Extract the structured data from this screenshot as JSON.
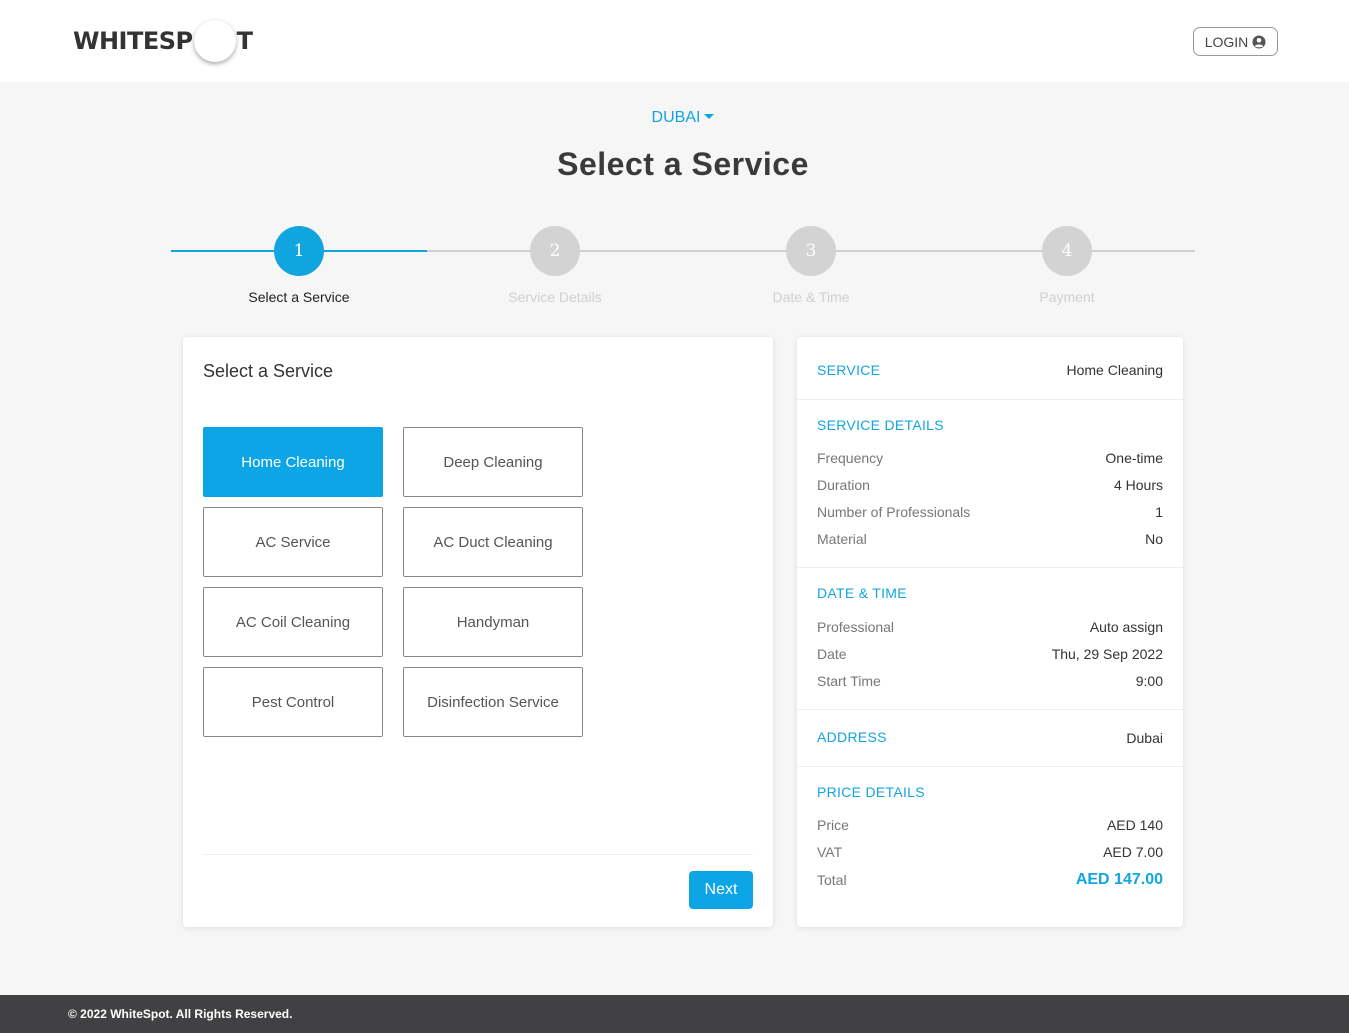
{
  "header": {
    "logo_left": "WHITESP",
    "logo_right": "T",
    "login_label": "LOGIN",
    "login_icon": "user-circle-icon"
  },
  "city": {
    "label": "DUBAI",
    "icon": "caret-down-icon"
  },
  "page_title": "Select a Service",
  "steps": [
    {
      "number": "1",
      "label": "Select a Service",
      "active": true
    },
    {
      "number": "2",
      "label": "Service Details",
      "active": false
    },
    {
      "number": "3",
      "label": "Date & Time",
      "active": false
    },
    {
      "number": "4",
      "label": "Payment",
      "active": false
    }
  ],
  "services_card": {
    "title": "Select a Service",
    "services": [
      {
        "label": "Home Cleaning",
        "selected": true
      },
      {
        "label": "Deep Cleaning",
        "selected": false
      },
      {
        "label": "AC Service",
        "selected": false
      },
      {
        "label": "AC Duct Cleaning",
        "selected": false
      },
      {
        "label": "AC Coil Cleaning",
        "selected": false
      },
      {
        "label": "Handyman",
        "selected": false
      },
      {
        "label": "Pest Control",
        "selected": false
      },
      {
        "label": "Disinfection Service",
        "selected": false
      }
    ],
    "next_label": "Next"
  },
  "summary": {
    "service": {
      "heading": "SERVICE",
      "value": "Home Cleaning"
    },
    "service_details": {
      "heading": "SERVICE DETAILS",
      "rows": [
        {
          "key": "Frequency",
          "value": "One-time"
        },
        {
          "key": "Duration",
          "value": "4 Hours"
        },
        {
          "key": "Number of Professionals",
          "value": "1"
        },
        {
          "key": "Material",
          "value": "No"
        }
      ]
    },
    "date_time": {
      "heading": "DATE & TIME",
      "rows": [
        {
          "key": "Professional",
          "value": "Auto assign"
        },
        {
          "key": "Date",
          "value": "Thu, 29 Sep 2022"
        },
        {
          "key": "Start Time",
          "value": "9:00"
        }
      ]
    },
    "address": {
      "heading": "ADDRESS",
      "value": "Dubai"
    },
    "price_details": {
      "heading": "PRICE DETAILS",
      "rows": [
        {
          "key": "Price",
          "value": "AED 140"
        },
        {
          "key": "VAT",
          "value": "AED 7.00"
        },
        {
          "key": "Total",
          "value": "AED 147.00"
        }
      ]
    }
  },
  "footer": {
    "text": "© 2022 WhiteSpot. All Rights Reserved."
  },
  "colors": {
    "accent": "#11a5e0",
    "footer_bg": "#414143",
    "step_inactive": "#d3d3d3"
  }
}
